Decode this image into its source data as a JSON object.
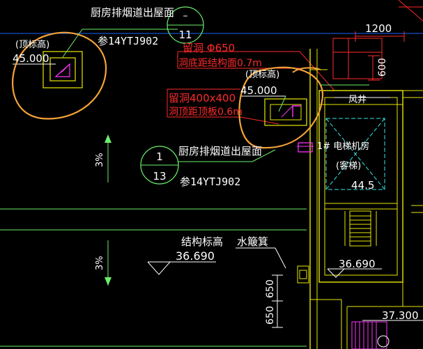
{
  "drawing": {
    "kitchen_flue_top": "厨房排烟道出屋面",
    "kitchen_flue_mid": "厨房排烟道出屋面",
    "ref_top": "参14YTJ902",
    "ref_mid": "参14YTJ902",
    "bubble_top": {
      "num": "–",
      "den": "11"
    },
    "bubble_mid": {
      "num": "1",
      "den": "13"
    },
    "top_elev_label_left": "(顶标高)",
    "top_elev_value_left": "45.000",
    "top_elev_label_right": "(顶标高)",
    "top_elev_value_right": "45.000",
    "hole_phi": "留洞 Φ650",
    "hole_phi_note": "洞底距结构面0.7m",
    "hole_rect": "留洞400x400",
    "hole_rect_note": "洞顶距顶板0.6m",
    "dim_1200": "1200",
    "dim_600": "600",
    "shaft": "风井",
    "elevator_room": "1# 电梯机房",
    "elevator_sub": "(客梯)",
    "elev_44": "44.5",
    "slope_upper": "3%",
    "slope_lower": "3%",
    "struct_elev_label": "结构标高",
    "struct_elev_value": "36.690",
    "water_trough": "水簸箕",
    "elev_right": "36.690",
    "dim_650a": "650",
    "dim_650b": "650",
    "elev_bottom_right": "37.300"
  },
  "colors": {
    "background": "#000000",
    "white": "#ffffff",
    "yellow": "#e8e800",
    "green": "#22e022",
    "red": "#ff2a2a",
    "magenta": "#ff33ff",
    "cyan": "#33e6e6",
    "orange": "#f5a33a"
  }
}
